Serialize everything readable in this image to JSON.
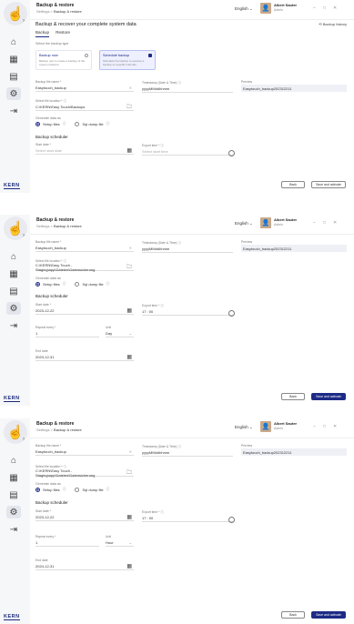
{
  "app": {
    "title": "Backup & restore",
    "breadcrumb_root": "Settings",
    "breadcrumb_sep": ">",
    "breadcrumb_current": "Backup & restore",
    "language": "English",
    "language_arrow": "⌄",
    "user_name": "Albert Sauter",
    "user_role": "Admin",
    "brand": "KERN"
  },
  "icons": {
    "logo": "hand-touch-icon",
    "home": "⌂",
    "grid": "▦",
    "doc": "▤",
    "settings": "⚙",
    "logout": "⇥",
    "minimize": "–",
    "maximize": "□",
    "close": "✕"
  },
  "screens": [
    {
      "heading": "Backup & recover your complete system data",
      "backup_history": "Backup history",
      "tabs": [
        "Backup",
        "Restore"
      ],
      "select_type_label": "Select the backup type",
      "types": [
        {
          "title": "Backup now",
          "desc": "Backup now to create a backup of the system instance."
        },
        {
          "title": "Schedule backup",
          "desc": "Schedule the backup to execute a backup on specific intervals."
        }
      ],
      "fields": {
        "backup_file_name_label": "Backup file name *",
        "backup_file_name": "Easytouch_backup",
        "timestamp_label": "Timestamp (Date & Time) ⓘ",
        "timestamp": "yyyyMMddhhmm",
        "preview_label": "Preview",
        "preview": "Easytouch_backup202312211",
        "folder_label": "Select file location * ⓘ",
        "folder": "C:\\KERN\\Easy Touch\\Backups",
        "generate_data_label": "Generate data as",
        "generate_option_1": "Setup files",
        "generate_option_2": "Sql dump file",
        "schedule_heading": "Backup scheduler",
        "start_date_label": "Start date *",
        "start_date_placeholder": "Select start date",
        "start_time_label": "Export time * ⓘ",
        "start_time_placeholder": "Select start time"
      },
      "buttons": {
        "back": "Back",
        "save": "Save and activate"
      }
    },
    {
      "fields": {
        "backup_file_name_label": "Backup file name *",
        "backup_file_name": "Easytouch_backup",
        "timestamp_label": "Timestamp (Date & Time) ⓘ",
        "timestamp": "yyyyMMddhhmm",
        "preview_label": "Preview",
        "preview": "Easytouch_backup202312211",
        "folder_label": "Select file location * ⓘ",
        "folder": "C:\\KERN\\Easy Touch - Staging\\app\\Dateien\\Datensicherung",
        "generate_data_label": "Generate data as",
        "generate_option_1": "Setup files",
        "generate_option_2": "Sql dump file",
        "schedule_heading": "Backup scheduler",
        "start_date_label": "Start date *",
        "start_date": "2023-12-22",
        "start_time_label": "Export time * ⓘ",
        "start_time": "17 : 00",
        "repeat_label": "Repeat every *",
        "repeat_value": "1",
        "unit_label": "Unit",
        "unit_value": "Day",
        "end_date_label": "End date",
        "end_date": "2023-12-31"
      },
      "buttons": {
        "back": "Back",
        "save": "Save and activate"
      }
    },
    {
      "fields": {
        "backup_file_name_label": "Backup file name *",
        "backup_file_name": "Easytouch_backup",
        "timestamp_label": "Timestamp (Date & Time) ⓘ",
        "timestamp": "yyyyMMddhhmm",
        "preview_label": "Preview",
        "preview": "Easytouch_backup202312211",
        "folder_label": "Select file location * ⓘ",
        "folder": "C:\\KERN\\Easy Touch - Staging\\app\\Dateien\\Datensicherung",
        "generate_data_label": "Generate data as",
        "generate_option_1": "Setup files",
        "generate_option_2": "Sql dump file",
        "schedule_heading": "Backup scheduler",
        "start_date_label": "Start date *",
        "start_date": "2023-12-22",
        "start_time_label": "Export time * ⓘ",
        "start_time": "17 : 00",
        "repeat_label": "Repeat every *",
        "repeat_value": "1",
        "unit_label": "Unit",
        "unit_value": "Hour",
        "end_date_label": "End date",
        "end_date": "2024-12-31"
      },
      "buttons": {
        "back": "Back",
        "save": "Save and activate"
      }
    }
  ]
}
